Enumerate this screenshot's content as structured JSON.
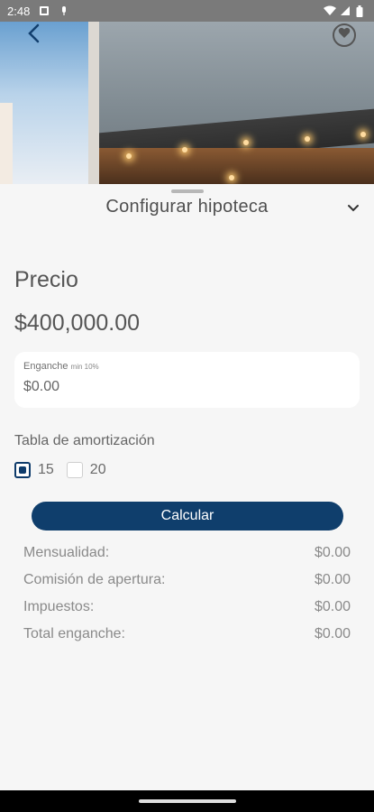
{
  "status_bar": {
    "time": "2:48"
  },
  "sheet": {
    "title": "Configurar hipoteca"
  },
  "price": {
    "label": "Precio",
    "value": "$400,000.00"
  },
  "down_payment": {
    "label": "Enganche",
    "hint": "min 10%",
    "value": "$0.00"
  },
  "amortization": {
    "label": "Tabla de amortización",
    "options": [
      {
        "label": "15",
        "selected": true
      },
      {
        "label": "20",
        "selected": false
      }
    ]
  },
  "calculate_button": "Calcular",
  "summary": [
    {
      "label": "Mensualidad:",
      "value": "$0.00"
    },
    {
      "label": "Comisión de apertura:",
      "value": "$0.00"
    },
    {
      "label": "Impuestos:",
      "value": "$0.00"
    },
    {
      "label": "Total enganche:",
      "value": "$0.00"
    }
  ],
  "colors": {
    "primary": "#0f3e6c",
    "background": "#f6f6f6"
  }
}
